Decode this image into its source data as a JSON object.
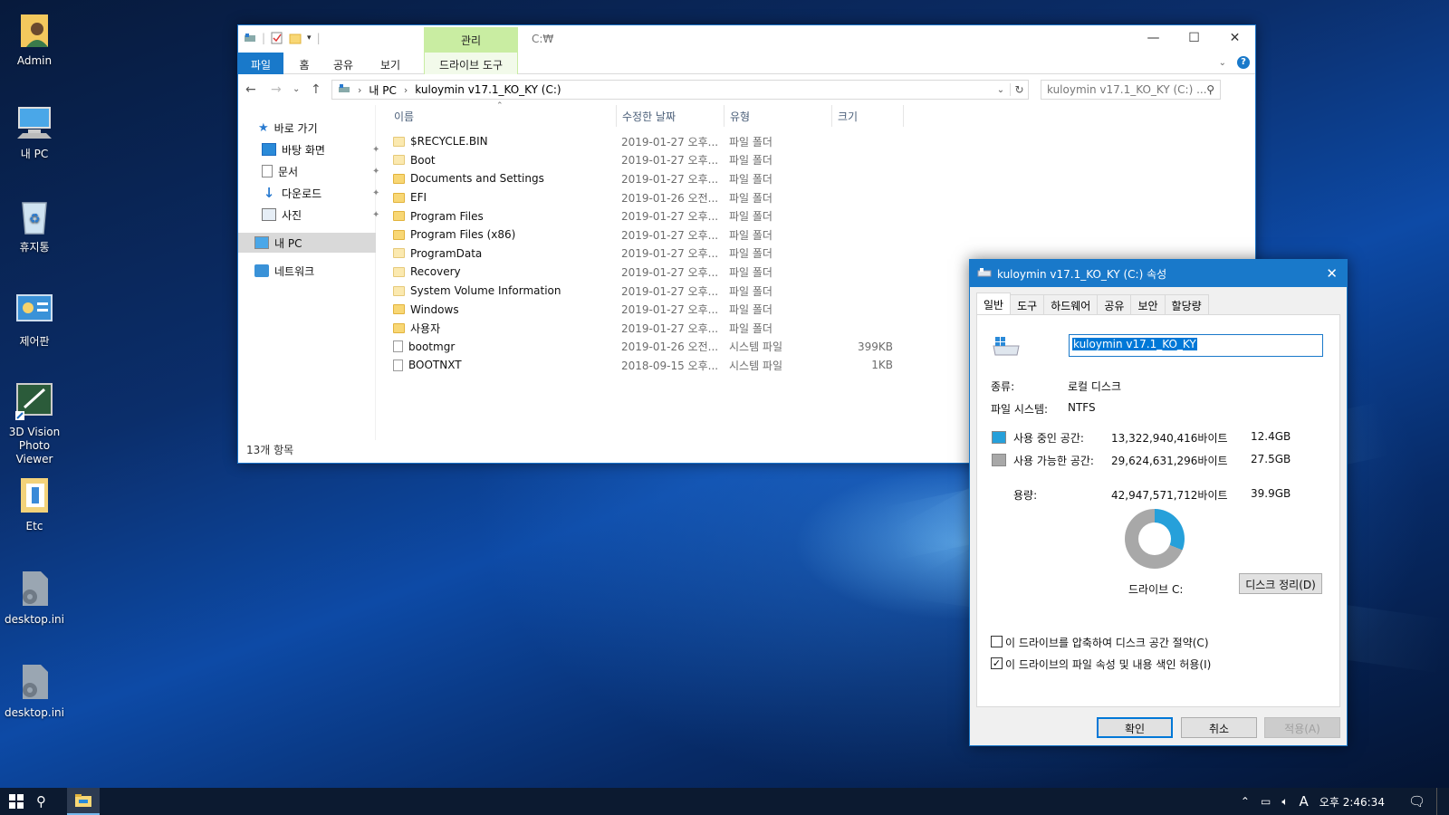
{
  "desktop": {
    "icons": [
      {
        "label": "Admin",
        "icon": "user-folder-icon"
      },
      {
        "label": "내 PC",
        "icon": "computer-icon"
      },
      {
        "label": "휴지통",
        "icon": "recycle-bin-icon"
      },
      {
        "label": "제어판",
        "icon": "control-panel-icon"
      },
      {
        "label": "3D Vision Photo Viewer",
        "icon": "photo-viewer-icon"
      },
      {
        "label": "Etc",
        "icon": "folder-icon"
      },
      {
        "label": "desktop.ini",
        "icon": "settings-file-icon"
      },
      {
        "label": "desktop.ini",
        "icon": "settings-file-icon"
      }
    ]
  },
  "explorer": {
    "title_path": "C:₩",
    "context_tab_group": "관리",
    "ribbon_tabs": [
      "파일",
      "홈",
      "공유",
      "보기",
      "드라이브 도구"
    ],
    "address": {
      "crumbs": [
        "내 PC",
        "kuloymin v17.1_KO_KY (C:)"
      ]
    },
    "search_placeholder": "kuloymin v17.1_KO_KY (C:) ...",
    "nav": {
      "quick_access": "바로 가기",
      "items": [
        "바탕 화면",
        "문서",
        "다운로드",
        "사진"
      ],
      "this_pc": "내 PC",
      "network": "네트워크"
    },
    "columns": [
      "이름",
      "수정한 날짜",
      "유형",
      "크기"
    ],
    "files": [
      {
        "name": "$RECYCLE.BIN",
        "date": "2019-01-27 오후...",
        "type": "파일 폴더",
        "size": "",
        "kind": "folder-pale"
      },
      {
        "name": "Boot",
        "date": "2019-01-27 오후...",
        "type": "파일 폴더",
        "size": "",
        "kind": "folder-pale"
      },
      {
        "name": "Documents and Settings",
        "date": "2019-01-27 오후...",
        "type": "파일 폴더",
        "size": "",
        "kind": "folder-link"
      },
      {
        "name": "EFI",
        "date": "2019-01-26 오전...",
        "type": "파일 폴더",
        "size": "",
        "kind": "folder"
      },
      {
        "name": "Program Files",
        "date": "2019-01-27 오후...",
        "type": "파일 폴더",
        "size": "",
        "kind": "folder"
      },
      {
        "name": "Program Files (x86)",
        "date": "2019-01-27 오후...",
        "type": "파일 폴더",
        "size": "",
        "kind": "folder"
      },
      {
        "name": "ProgramData",
        "date": "2019-01-27 오후...",
        "type": "파일 폴더",
        "size": "",
        "kind": "folder-pale"
      },
      {
        "name": "Recovery",
        "date": "2019-01-27 오후...",
        "type": "파일 폴더",
        "size": "",
        "kind": "folder-pale"
      },
      {
        "name": "System Volume Information",
        "date": "2019-01-27 오후...",
        "type": "파일 폴더",
        "size": "",
        "kind": "folder-pale"
      },
      {
        "name": "Windows",
        "date": "2019-01-27 오후...",
        "type": "파일 폴더",
        "size": "",
        "kind": "folder"
      },
      {
        "name": "사용자",
        "date": "2019-01-27 오후...",
        "type": "파일 폴더",
        "size": "",
        "kind": "folder"
      },
      {
        "name": "bootmgr",
        "date": "2019-01-26 오전...",
        "type": "시스템 파일",
        "size": "399KB",
        "kind": "file"
      },
      {
        "name": "BOOTNXT",
        "date": "2018-09-15 오후...",
        "type": "시스템 파일",
        "size": "1KB",
        "kind": "file"
      }
    ],
    "status": "13개 항목"
  },
  "properties": {
    "title": "kuloymin v17.1_KO_KY (C:) 속성",
    "tabs": [
      "일반",
      "도구",
      "하드웨어",
      "공유",
      "보안",
      "할당량"
    ],
    "volume_name": "kuloymin v17.1_KO_KY",
    "type_label": "종류:",
    "type_value": "로컬 디스크",
    "fs_label": "파일 시스템:",
    "fs_value": "NTFS",
    "used_label": "사용 중인 공간:",
    "used_bytes": "13,322,940,416바이트",
    "used_size": "12.4GB",
    "free_label": "사용 가능한 공간:",
    "free_bytes": "29,624,631,296바이트",
    "free_size": "27.5GB",
    "cap_label": "용량:",
    "cap_bytes": "42,947,571,712바이트",
    "cap_size": "39.9GB",
    "drive_label": "드라이브 C:",
    "cleanup_button": "디스크 정리(D)",
    "compress_label": "이 드라이브를 압축하여 디스크 공간 절약(C)",
    "compress_checked": false,
    "index_label": "이 드라이브의 파일 속성 및 내용 색인 허용(I)",
    "index_checked": true,
    "ok": "확인",
    "cancel": "취소",
    "apply": "적용(A)",
    "used_fraction": 0.31,
    "colors": {
      "used": "#26a0da",
      "free": "#a8a8a8"
    }
  },
  "taskbar": {
    "time": "오후 2:46:34",
    "ime": "A"
  }
}
